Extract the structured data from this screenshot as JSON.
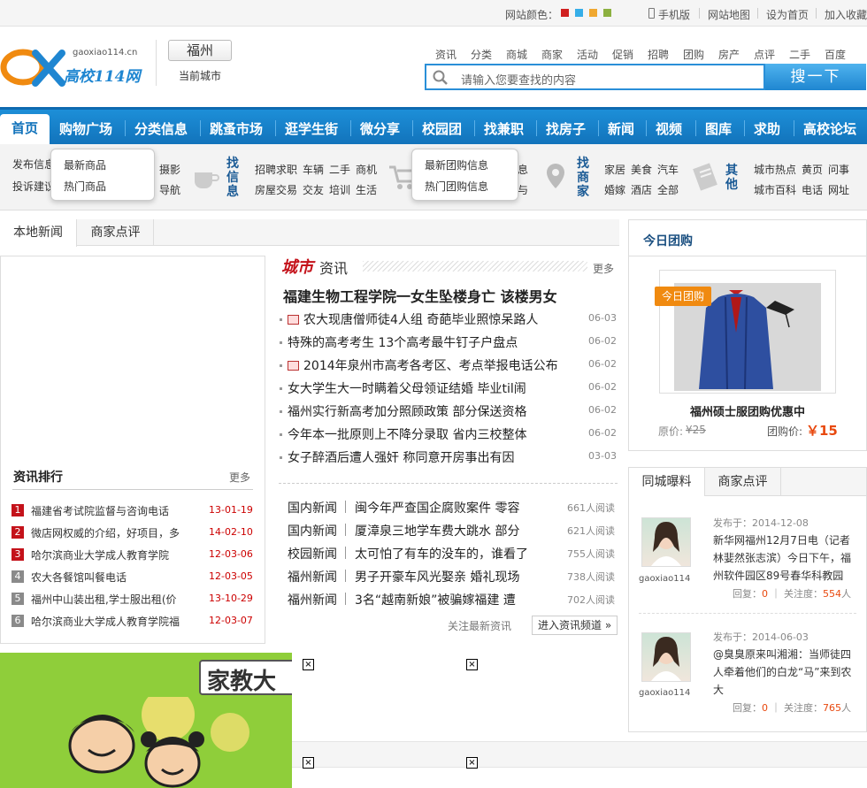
{
  "topbar": {
    "color_label": "网站颜色：",
    "swatches": [
      "#d02020",
      "#36aee8",
      "#f0a830",
      "#8cb040"
    ],
    "mobile": "手机版",
    "sitemap": "网站地图",
    "homepage": "设为首页",
    "favorite": "加入收藏"
  },
  "header": {
    "logo_domain": "gaoxiao114.cn",
    "logo_text": "高校114网",
    "city": "福州",
    "current_city": "当前城市",
    "quick_links": [
      "资讯",
      "分类",
      "商城",
      "商家",
      "活动",
      "促销",
      "招聘",
      "团购",
      "房产",
      "点评",
      "二手",
      "百度"
    ],
    "search_placeholder": "请输入您要查找的内容",
    "search_button": "搜一下"
  },
  "nav": {
    "home": "首页",
    "items": [
      "购物广场",
      "分类信息",
      "跳蚤市场",
      "逛学生街",
      "微分享",
      "校园团",
      "找兼职",
      "找房子",
      "新闻",
      "视频",
      "图库",
      "求助",
      "高校论坛"
    ]
  },
  "subnav": {
    "left_links": [
      "发布信息",
      "投诉建议"
    ],
    "shop_dropdown": [
      "最新商品",
      "热门商品"
    ],
    "photo_links": [
      "摄影",
      "导航"
    ],
    "info_title": "找信息",
    "info_links": [
      [
        "招聘求职",
        "车辆",
        "二手",
        "商机"
      ],
      [
        "房屋交易",
        "交友",
        "培训",
        "生活"
      ]
    ],
    "group_dropdown": [
      "最新团购信息",
      "热门团购信息"
    ],
    "partial_links": [
      "息",
      "与"
    ],
    "merchant_title": "找商家",
    "merchant_links": [
      [
        "家居",
        "美食",
        "汽车"
      ],
      [
        "婚嫁",
        "酒店",
        "全部"
      ]
    ],
    "other_title": "其他",
    "other_links": [
      [
        "城市热点",
        "黄页",
        "问事"
      ],
      [
        "城市百科",
        "电话",
        "网址"
      ]
    ]
  },
  "tabs_news": [
    "本地新闻",
    "商家点评"
  ],
  "rank": {
    "title": "资讯排行",
    "more": "更多",
    "items": [
      {
        "n": "1",
        "t": "福建省考试院监督与咨询电话",
        "d": "13-01-19"
      },
      {
        "n": "2",
        "t": "微店网权威的介绍，好项目，多",
        "d": "14-02-10"
      },
      {
        "n": "3",
        "t": "哈尔滨商业大学成人教育学院",
        "d": "12-03-06"
      },
      {
        "n": "4",
        "t": "农大各餐馆叫餐电话",
        "d": "12-03-05"
      },
      {
        "n": "5",
        "t": "福州中山装出租,学士服出租(价",
        "d": "13-10-29"
      },
      {
        "n": "6",
        "t": "哈尔滨商业大学成人教育学院福",
        "d": "12-03-07"
      }
    ]
  },
  "city_news": {
    "title_a": "城市",
    "title_b": "资讯",
    "more": "更多",
    "headline": "福建生物工程学院一女生坠楼身亡 该楼男女",
    "items": [
      {
        "t": "农大现唐僧师徒4人组 奇葩毕业照惊呆路人",
        "d": "06-03",
        "img": true
      },
      {
        "t": "特殊的高考考生 13个高考最牛钉子户盘点",
        "d": "06-02",
        "img": false
      },
      {
        "t": "2014年泉州市高考各考区、考点举报电话公布",
        "d": "06-02",
        "img": true
      },
      {
        "t": "女大学生大一时瞒着父母领证结婚 毕业til闹",
        "d": "06-02",
        "img": false
      },
      {
        "t": "福州实行新高考加分照顾政策 部分保送资格",
        "d": "06-02",
        "img": false
      },
      {
        "t": "今年本一批原则上不降分录取 省内三校整体",
        "d": "06-02",
        "img": false
      },
      {
        "t": "女子醉酒后遭人强奸 称同意开房事出有因",
        "d": "03-03",
        "img": false
      }
    ],
    "list2": [
      {
        "c": "国内新闻",
        "t": "闽今年严查国企腐败案件 零容",
        "r": "661人阅读"
      },
      {
        "c": "国内新闻",
        "t": "厦漳泉三地学车费大跳水 部分",
        "r": "621人阅读"
      },
      {
        "c": "校园新闻",
        "t": "太可怕了有车的没车的，谁看了",
        "r": "755人阅读"
      },
      {
        "c": "福州新闻",
        "t": "男子开豪车风光娶亲 婚礼现场",
        "r": "738人阅读"
      },
      {
        "c": "福州新闻",
        "t": "3名“越南新娘”被骗嫁福建 遭",
        "r": "702人阅读"
      }
    ],
    "follow": "关注最新资讯",
    "enter": "进入资讯频道 »"
  },
  "groupbuy": {
    "title": "今日团购",
    "tag": "今日团购",
    "product": "福州硕士服团购优惠中",
    "orig_label": "原价:",
    "orig_price": "¥25",
    "price_label": "团购价:",
    "price": "￥15"
  },
  "reports": {
    "tabs": [
      "同城曝料",
      "商家点评"
    ],
    "items": [
      {
        "user": "gaoxiao114",
        "pub": "发布于：2014-12-08",
        "text": "新华网福州12月7日电（记者林婓然张志滨）今日下午，福州软件园区89号春华科教园",
        "reply_label": "回复：",
        "reply": "0",
        "attn_label": "关注度：",
        "attn": "554",
        "unit": "人"
      },
      {
        "user": "gaoxiao114",
        "pub": "发布于：2014-06-03",
        "text": "@臭臭原来叫湘湘：当师徒四人牵着他们的白龙“马”来到农大",
        "reply_label": "回复：",
        "reply": "0",
        "attn_label": "关注度：",
        "attn": "765",
        "unit": "人"
      }
    ]
  },
  "banner": {
    "text": "家教大"
  }
}
